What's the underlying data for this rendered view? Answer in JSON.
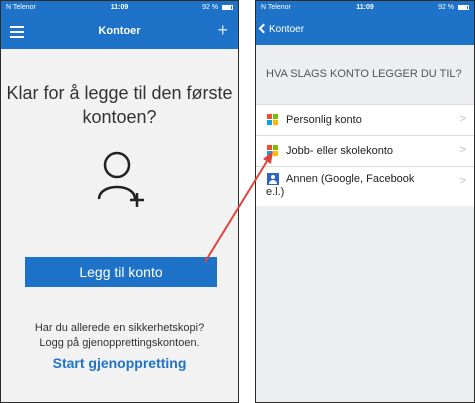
{
  "left_screen": {
    "status": {
      "carrier": "N Telenor",
      "time": "11:09",
      "battery": "92 %"
    },
    "nav": {
      "title": "Kontoer",
      "add_icon": "+"
    },
    "headline": "Klar for å legge til den første kontoen?",
    "add_button_label": "Legg til konto",
    "backup_question": "Har du allerede en sikkerhetskopi?",
    "backup_hint": "Logg på gjenopprettingskontoen.",
    "restore_link": "Start gjenoppretting"
  },
  "right_screen": {
    "status": {
      "carrier": "N Telenor",
      "time": "11:09",
      "battery": "92 %"
    },
    "nav": {
      "back_label": "Kontoer"
    },
    "section_title": "HVA SLAGS KONTO LEGGER DU TIL?",
    "accounts": [
      {
        "label": "Personlig konto",
        "icon": "microsoft-logo-icon"
      },
      {
        "label": "Jobb- eller skolekonto",
        "icon": "microsoft-logo-icon"
      },
      {
        "label": "Annen (Google, Facebook e.l.)",
        "icon": "person-card-icon"
      }
    ],
    "chevron": ">"
  },
  "colors": {
    "accent": "#1e73c9",
    "annotation_arrow": "#e0443c"
  }
}
